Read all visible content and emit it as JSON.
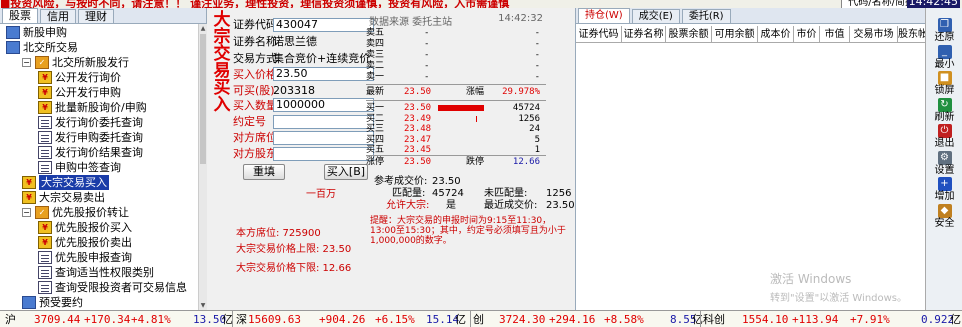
{
  "topbar": {
    "ticker": "■投资风险，与按时不同，请注意！！ 谨注业务，理性投资，理信投资须谨慎，投资有风险，入市需谨慎",
    "search_box": "代码/名称/简拼",
    "clock": "14:42:45"
  },
  "left_tabs": [
    "股票",
    "信用",
    "理财"
  ],
  "tree": [
    {
      "label": "新股申购",
      "level": 0,
      "icon": "group"
    },
    {
      "label": "北交所交易",
      "level": 0,
      "icon": "group"
    },
    {
      "label": "北交所新股发行",
      "level": 1,
      "icon": "check",
      "pm": "−"
    },
    {
      "label": "公开发行询价",
      "level": 2,
      "icon": "bag"
    },
    {
      "label": "公开发行申购",
      "level": 2,
      "icon": "bag"
    },
    {
      "label": "批量新股询价/申购",
      "level": 2,
      "icon": "bag"
    },
    {
      "label": "发行询价委托查询",
      "level": 2,
      "icon": "doc"
    },
    {
      "label": "发行申购委托查询",
      "level": 2,
      "icon": "doc"
    },
    {
      "label": "发行询价结果查询",
      "level": 2,
      "icon": "doc"
    },
    {
      "label": "申购中签查询",
      "level": 2,
      "icon": "doc"
    },
    {
      "label": "大宗交易买入",
      "level": 1,
      "icon": "bag",
      "selected": true
    },
    {
      "label": "大宗交易卖出",
      "level": 1,
      "icon": "bag"
    },
    {
      "label": "优先股报价转让",
      "level": 1,
      "icon": "check",
      "pm": "−"
    },
    {
      "label": "优先股报价买入",
      "level": 2,
      "icon": "bag"
    },
    {
      "label": "优先股报价卖出",
      "level": 2,
      "icon": "bag"
    },
    {
      "label": "优先股申报查询",
      "level": 2,
      "icon": "doc"
    },
    {
      "label": "查询适当性权限类别",
      "level": 2,
      "icon": "doc"
    },
    {
      "label": "查询受限投资者可交易信息",
      "level": 2,
      "icon": "doc"
    },
    {
      "label": "预受要约",
      "level": 1,
      "icon": "group"
    }
  ],
  "form": {
    "vertical_title": "大宗交易买入",
    "code_label": "证券代码",
    "code_value": "430047",
    "name_label": "证券名称",
    "name_value": "诺思兰德",
    "method_label": "交易方式",
    "method_value": "集合竞价+连续竞价",
    "price_label": "买入价格",
    "price_value": "23.50",
    "avail_label": "可买(股)",
    "avail_value": "203318",
    "qty_label": "买入数量",
    "qty_value": "1000000",
    "agree_label": "约定号",
    "cp_seat_label": "对方席位",
    "cp_holder_label": "对方股东",
    "reset_btn": "重填",
    "buy_btn": "买入[B]",
    "qty_hint": "一百万",
    "seat_info": "本方席位: 725900",
    "upper_limit": "大宗交易价格上限: 23.50",
    "lower_limit": "大宗交易价格下限: 12.66"
  },
  "quote": {
    "source": "数据来源 委托主站",
    "time": "14:42:32",
    "sells": [
      {
        "l": "卖五",
        "p": "-",
        "v": "-"
      },
      {
        "l": "卖四",
        "p": "-",
        "v": "-"
      },
      {
        "l": "卖三",
        "p": "-",
        "v": "-"
      },
      {
        "l": "卖二",
        "p": "-",
        "v": "-"
      },
      {
        "l": "卖一",
        "p": "-",
        "v": "-"
      }
    ],
    "latest_label": "最新",
    "latest": "23.50",
    "chg_label": "涨幅",
    "chg": "29.978%",
    "buys": [
      {
        "l": "买一",
        "p": "23.50",
        "v": "45724",
        "bar": 1.0
      },
      {
        "l": "买二",
        "p": "23.49",
        "v": "1256",
        "bar": 0.03
      },
      {
        "l": "买三",
        "p": "23.48",
        "v": "24",
        "bar": 0
      },
      {
        "l": "买四",
        "p": "23.47",
        "v": "5",
        "bar": 0
      },
      {
        "l": "买五",
        "p": "23.45",
        "v": "1",
        "bar": 0
      }
    ],
    "limit_up_label": "涨停",
    "limit_up": "23.50",
    "limit_dn_label": "跌停",
    "limit_dn": "12.66",
    "ref_label": "参考成交价:",
    "ref": "23.50",
    "matched_label": "匹配量:",
    "matched": "45724",
    "unmatched_label": "未匹配量:",
    "unmatched": "1256",
    "allow_label": "允许大宗:",
    "allow": "是",
    "recent_label": "最近成交价:",
    "recent": "23.50",
    "notice": "提醒：大宗交易的申报时间为9:15至11:30，13:00至15:30；其中，约定号必须填写且为小于1,000,000的数字。"
  },
  "hold": {
    "tabs": [
      "持仓(W)",
      "成交(E)",
      "委托(R)"
    ],
    "columns": [
      "证券代码",
      "证券名称",
      "股票余额",
      "可用余额",
      "成本价",
      "市价",
      "市值",
      "交易市场",
      "股东帐"
    ]
  },
  "tools": [
    {
      "name": "还原",
      "icon": "restore-icon",
      "color": "#3060b0"
    },
    {
      "name": "最小",
      "icon": "minimize-icon",
      "color": "#3060b0"
    },
    {
      "name": "锁屏",
      "icon": "lock-icon",
      "color": "#d09020"
    },
    {
      "name": "刷新",
      "icon": "refresh-icon",
      "color": "#209040"
    },
    {
      "name": "退出",
      "icon": "exit-icon",
      "color": "#c02020"
    },
    {
      "name": "设置",
      "icon": "gear-icon",
      "color": "#607080"
    },
    {
      "name": "增加",
      "icon": "add-icon",
      "color": "#2050c0"
    },
    {
      "name": "安全",
      "icon": "shield-icon",
      "color": "#c08020"
    }
  ],
  "status": {
    "sh": {
      "name": "沪",
      "idx": "3709.44",
      "chg": "+170.34",
      "pct": "+4.81%",
      "amt": "13.50",
      "unit": "亿"
    },
    "sz": {
      "name": "深",
      "idx": "15609.63",
      "chg": "+904.26",
      "pct": "+6.15%",
      "amt": "15.14",
      "unit": "亿"
    },
    "cy": {
      "name": "创",
      "idx": "3724.30",
      "chg": "+294.16",
      "pct": "+8.58%",
      "amt": "8.55",
      "unit": "亿"
    },
    "kc": {
      "name": "科创",
      "idx": "1554.10",
      "chg": "+113.94",
      "pct": "+7.91%",
      "amt": "0.922",
      "unit": "亿"
    }
  },
  "watermark": {
    "line1": "激活 Windows",
    "line2": "转到\"设置\"以激活 Windows。"
  }
}
